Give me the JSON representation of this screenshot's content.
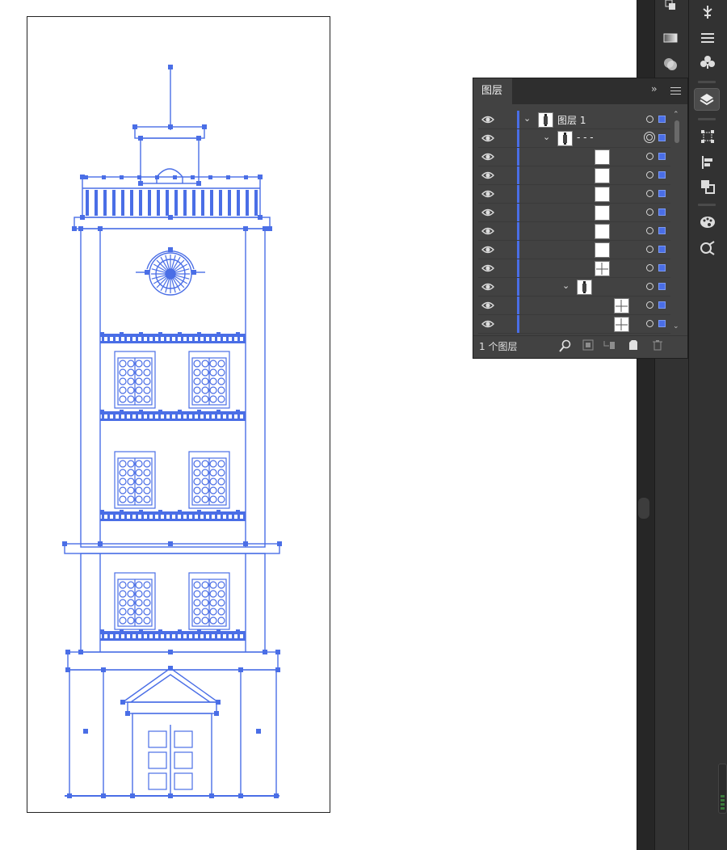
{
  "panel": {
    "tab_label": "图层",
    "collapse_label": "››",
    "footer_count": "1 个图层"
  },
  "layers": [
    {
      "name": "图层 1",
      "indent": 0,
      "expanded": true,
      "thumb": "tower",
      "target": "single"
    },
    {
      "name": "- - -",
      "indent": 1,
      "expanded": true,
      "thumb": "tower",
      "target": "double"
    },
    {
      "name": "",
      "indent": 3,
      "thumb": "blank",
      "target": "single"
    },
    {
      "name": "",
      "indent": 3,
      "thumb": "blank",
      "target": "single"
    },
    {
      "name": "",
      "indent": 3,
      "thumb": "blank",
      "target": "single"
    },
    {
      "name": "",
      "indent": 3,
      "thumb": "blank",
      "target": "single"
    },
    {
      "name": "",
      "indent": 3,
      "thumb": "blank",
      "target": "single"
    },
    {
      "name": "",
      "indent": 3,
      "thumb": "blank",
      "target": "single"
    },
    {
      "name": "",
      "indent": 3,
      "thumb": "lines",
      "target": "single"
    },
    {
      "name": "",
      "indent": 2,
      "expanded": true,
      "thumb": "tower",
      "target": "single"
    },
    {
      "name": "",
      "indent": 4,
      "thumb": "lines",
      "target": "single"
    },
    {
      "name": "",
      "indent": 4,
      "thumb": "lines",
      "target": "single"
    }
  ],
  "colors": {
    "selection": "#4a6ee6",
    "panel_bg": "#424242",
    "dock_bg": "#323232"
  },
  "dock_icons": [
    "arrange-icon",
    "puppet-warp-icon",
    "gradient-icon",
    "stroke-icon",
    "transparency-icon",
    "symbols-icon",
    "layers-icon",
    "transform-icon",
    "align-icon",
    "pathfinder-icon",
    "color-guide-icon",
    "links-icon"
  ]
}
